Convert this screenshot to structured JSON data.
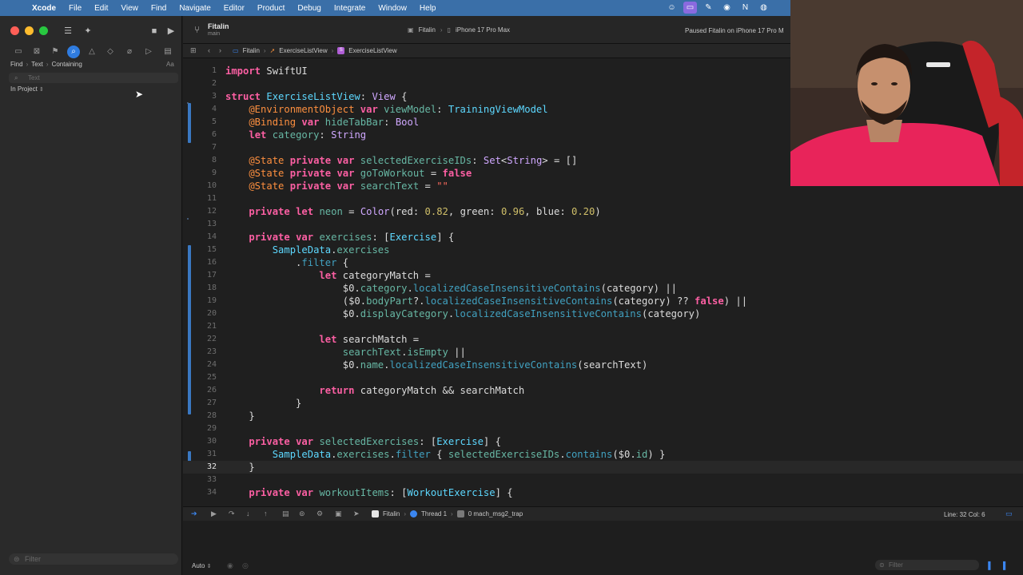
{
  "menubar": {
    "app_name": "Xcode",
    "items": [
      "File",
      "Edit",
      "View",
      "Find",
      "Navigate",
      "Editor",
      "Product",
      "Debug",
      "Integrate",
      "Window",
      "Help"
    ]
  },
  "navigator": {
    "find_mode": "Find",
    "find_type": "Text",
    "find_match": "Containing",
    "case_toggle": "Aa",
    "search_placeholder": "Text",
    "scope": "In Project",
    "filter_placeholder": "Filter"
  },
  "toolbar": {
    "project": "Fitalin",
    "branch": "main",
    "scheme": "Fitalin",
    "destination": "iPhone 17 Pro Max",
    "status": "Paused Fitalin on iPhone 17 Pro M"
  },
  "jumpbar": {
    "crumbs": [
      "Fitalin",
      "ExerciseListView",
      "ExerciseListView"
    ]
  },
  "code": {
    "current_line": 32,
    "lines": [
      {
        "n": "1"
      },
      {
        "n": "2"
      },
      {
        "n": "3"
      },
      {
        "n": "4"
      },
      {
        "n": "5"
      },
      {
        "n": "6"
      },
      {
        "n": "7"
      },
      {
        "n": "8"
      },
      {
        "n": "9"
      },
      {
        "n": "10"
      },
      {
        "n": "11"
      },
      {
        "n": "12"
      },
      {
        "n": "13"
      },
      {
        "n": "14"
      },
      {
        "n": "15"
      },
      {
        "n": "16"
      },
      {
        "n": "17"
      },
      {
        "n": "18"
      },
      {
        "n": "19"
      },
      {
        "n": "20"
      },
      {
        "n": "21"
      },
      {
        "n": "22"
      },
      {
        "n": "23"
      },
      {
        "n": "24"
      },
      {
        "n": "25"
      },
      {
        "n": "26"
      },
      {
        "n": "27"
      },
      {
        "n": "28"
      },
      {
        "n": "29"
      },
      {
        "n": "30"
      },
      {
        "n": "31"
      },
      {
        "n": "32"
      },
      {
        "n": "33"
      },
      {
        "n": "34"
      }
    ]
  },
  "source": {
    "l1": [
      "import",
      " SwiftUI"
    ],
    "l3": [
      "struct",
      " ",
      "ExerciseListView",
      ": ",
      "View",
      " {"
    ],
    "l4": [
      "    @EnvironmentObject ",
      "var",
      " ",
      "viewModel",
      ": ",
      "TrainingViewModel"
    ],
    "l5": [
      "    @Binding ",
      "var",
      " ",
      "hideTabBar",
      ": ",
      "Bool"
    ],
    "l6": [
      "    ",
      "let",
      " ",
      "category",
      ": ",
      "String"
    ],
    "l8": [
      "    @State ",
      "private",
      " ",
      "var",
      " ",
      "selectedExerciseIDs",
      ": ",
      "Set",
      "<",
      "String",
      "> = []"
    ],
    "l9": [
      "    @State ",
      "private",
      " ",
      "var",
      " ",
      "goToWorkout",
      " = ",
      "false"
    ],
    "l10": [
      "    @State ",
      "private",
      " ",
      "var",
      " ",
      "searchText",
      " = ",
      "\"\""
    ],
    "l12": [
      "    ",
      "private",
      " ",
      "let",
      " ",
      "neon",
      " = ",
      "Color",
      "(red: ",
      "0.82",
      ", green: ",
      "0.96",
      ", blue: ",
      "0.20",
      ")"
    ],
    "l14": [
      "    ",
      "private",
      " ",
      "var",
      " ",
      "exercises",
      ": [",
      "Exercise",
      "] {"
    ],
    "l15": [
      "        ",
      "SampleData",
      ".",
      "exercises"
    ],
    "l16": [
      "            .",
      "filter",
      " {"
    ],
    "l17": [
      "                ",
      "let",
      " categoryMatch ="
    ],
    "l18": [
      "                    $0.",
      "category",
      ".",
      "localizedCaseInsensitiveContains",
      "(category) ||"
    ],
    "l19": [
      "                    ($0.",
      "bodyPart",
      "?.",
      "localizedCaseInsensitiveContains",
      "(category) ?? ",
      "false",
      ") ||"
    ],
    "l20": [
      "                    $0.",
      "displayCategory",
      ".",
      "localizedCaseInsensitiveContains",
      "(category)"
    ],
    "l22": [
      "                ",
      "let",
      " searchMatch ="
    ],
    "l23": [
      "                    ",
      "searchText",
      ".",
      "isEmpty",
      " ||"
    ],
    "l24": [
      "                    $0.",
      "name",
      ".",
      "localizedCaseInsensitiveContains",
      "(searchText)"
    ],
    "l26": [
      "                ",
      "return",
      " categoryMatch && searchMatch"
    ],
    "l27": [
      "            }"
    ],
    "l28": [
      "    }"
    ],
    "l30": [
      "    ",
      "private",
      " ",
      "var",
      " ",
      "selectedExercises",
      ": [",
      "Exercise",
      "] {"
    ],
    "l31": [
      "        ",
      "SampleData",
      ".",
      "exercises",
      ".",
      "filter",
      " { ",
      "selectedExerciseIDs",
      ".",
      "contains",
      "($0.",
      "id",
      ") }"
    ],
    "l32": [
      "    }"
    ],
    "l34": [
      "    ",
      "private",
      " ",
      "var",
      " ",
      "workoutItems",
      ": [",
      "WorkoutExercise",
      "] {"
    ]
  },
  "debugbar": {
    "target": "Fitalin",
    "thread": "Thread 1",
    "frame": "0 mach_msg2_trap",
    "cursor_position": "Line: 32  Col: 6"
  },
  "bottom": {
    "output_mode": "Auto",
    "filter_placeholder": "Filter"
  },
  "colors": {
    "keyword": "#fc5fa3",
    "type": "#d0a8ff",
    "property": "#67b7a4",
    "method": "#41a1c0",
    "number": "#d0bf69",
    "string": "#fc6a5d",
    "accent": "#2f7ce0"
  }
}
